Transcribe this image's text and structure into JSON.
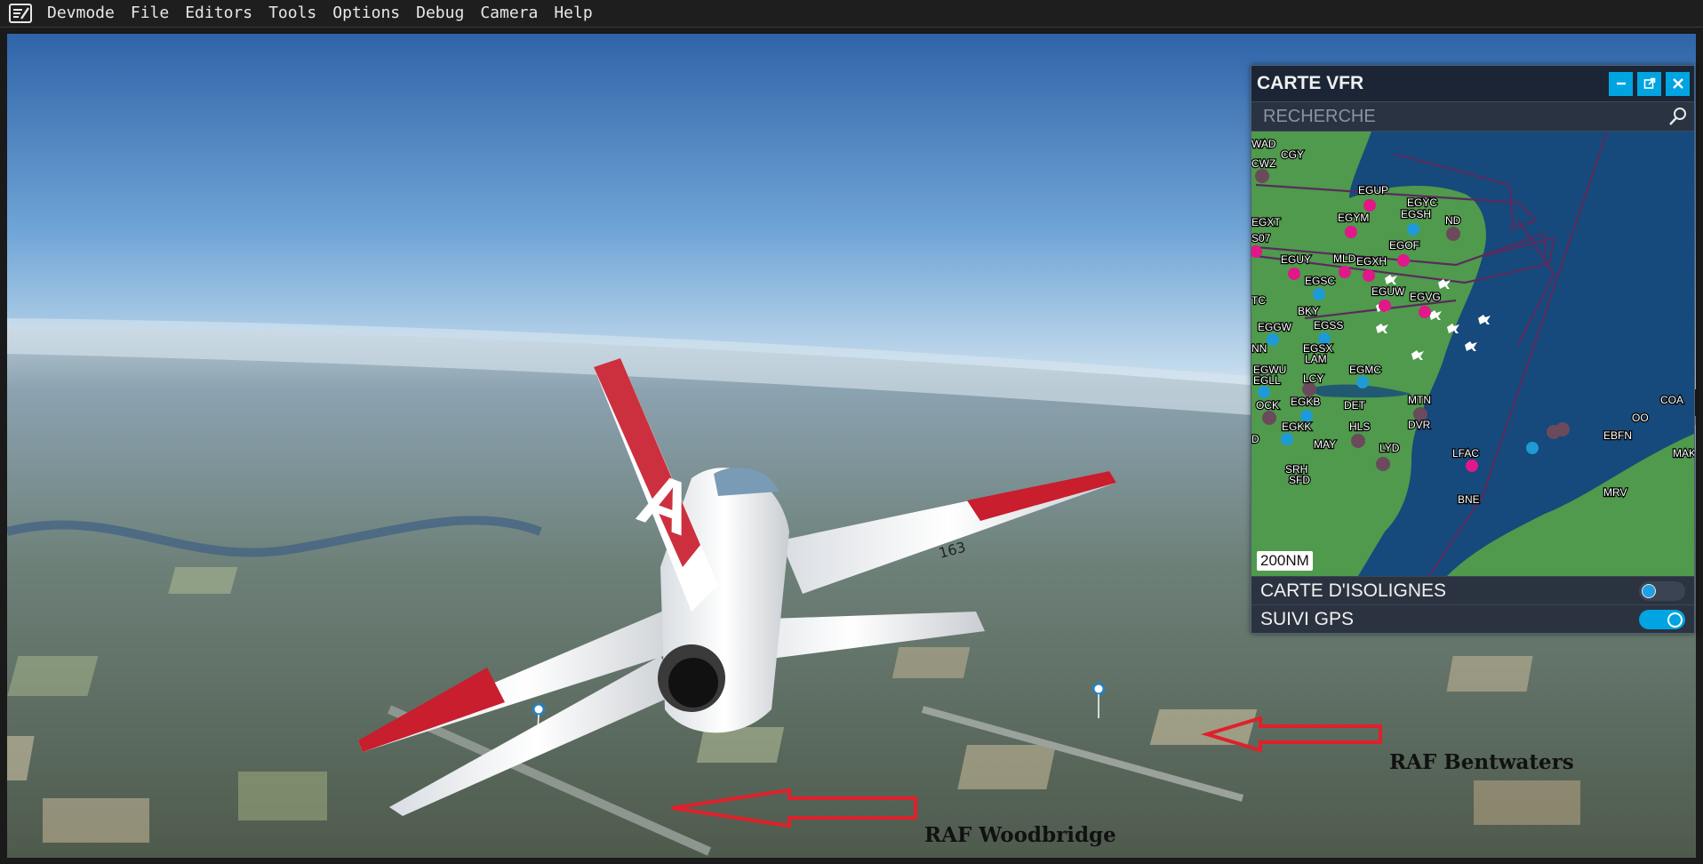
{
  "menubar": {
    "items": [
      "Devmode",
      "File",
      "Editors",
      "Tools",
      "Options",
      "Debug",
      "Camera",
      "Help"
    ]
  },
  "aircraft": {
    "tail_code": "A",
    "number": "163"
  },
  "vfr_panel": {
    "title": "CARTE VFR",
    "search_placeholder": "RECHERCHE",
    "scale": "200NM",
    "toggles": [
      {
        "label": "CARTE D'ISOLIGNES",
        "on": false
      },
      {
        "label": "SUIVI GPS",
        "on": true
      }
    ],
    "map_labels": [
      "WAD",
      "CWZ",
      "CGY",
      "EGUP",
      "EGYC",
      "EGSH",
      "ND",
      "EGXT",
      "EGYM",
      "S07",
      "EGOF",
      "EGUY",
      "MLD",
      "EGXH",
      "EGSC",
      "EGUW",
      "EGVG",
      "TC",
      "BKY",
      "EGSS",
      "EGGW",
      "NN",
      "EGSX",
      "LAM",
      "EGWU",
      "EGLL",
      "EGMC",
      "LCY",
      "OCK",
      "EGKB",
      "MTN",
      "DET",
      "COA",
      "EGKK",
      "HLS",
      "DVR",
      "OO",
      "EBFN",
      "D",
      "MAY",
      "LYD",
      "LFAC",
      "MAK",
      "SRH",
      "SFD",
      "MRV",
      "BNE"
    ],
    "colors": {
      "land": "#4f9a4c",
      "sea": "#16497c",
      "accent": "#00a4e0",
      "airspace": "#5a2b5e"
    }
  },
  "annotations": [
    {
      "text": "RAF Bentwaters"
    },
    {
      "text": "RAF Woodbridge"
    }
  ]
}
